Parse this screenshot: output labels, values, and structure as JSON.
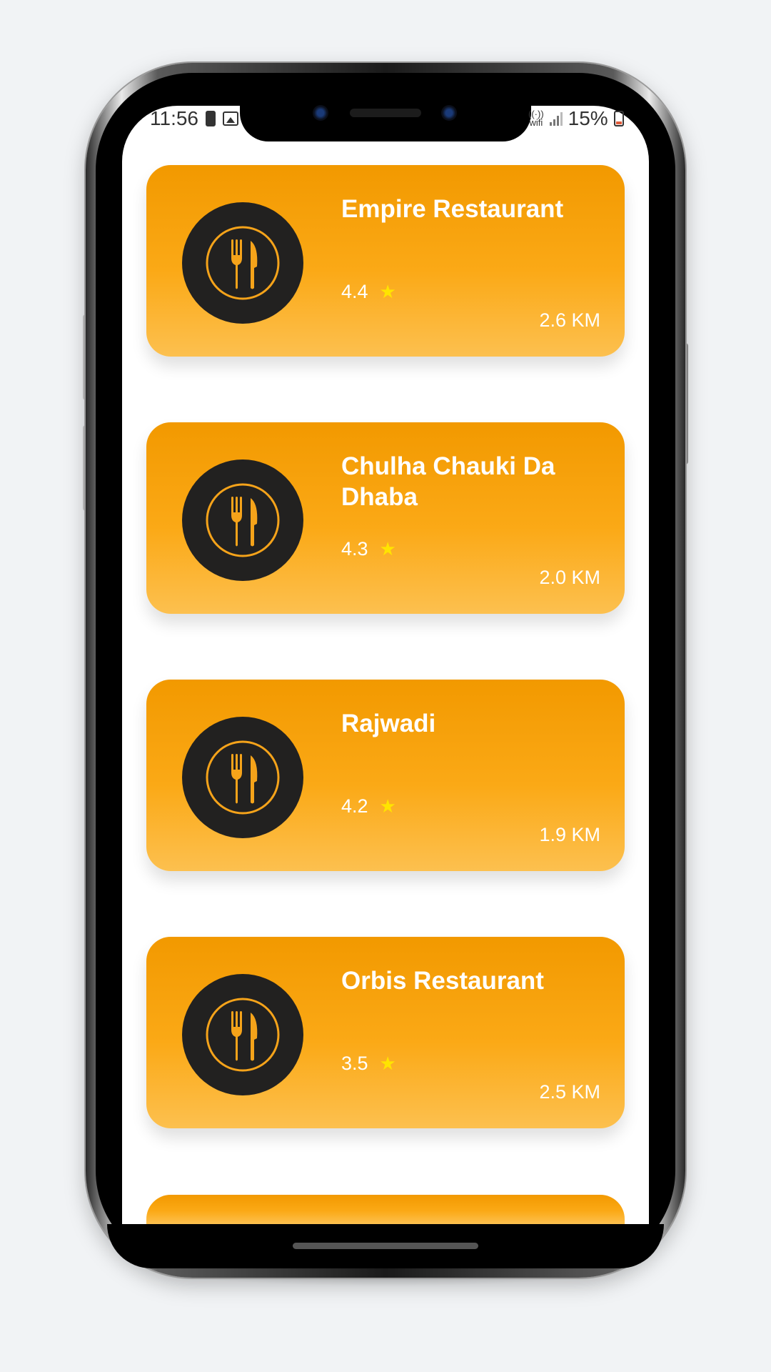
{
  "status_bar": {
    "time": "11:56",
    "wifi_label": "wifi",
    "battery_percent": "15%"
  },
  "restaurants": [
    {
      "name": "Empire Restaurant",
      "rating": "4.4",
      "distance": "2.6 KM"
    },
    {
      "name": "Chulha Chauki Da Dhaba",
      "rating": "4.3",
      "distance": "2.0 KM"
    },
    {
      "name": "Rajwadi",
      "rating": "4.2",
      "distance": "1.9 KM"
    },
    {
      "name": "Orbis Restaurant",
      "rating": "3.5",
      "distance": "2.5 KM"
    }
  ],
  "icons": {
    "card_icon": "fork-knife-plate-icon",
    "rating_icon": "star-icon"
  },
  "colors": {
    "card_top": "#f29900",
    "card_bottom": "#fcc04f",
    "plate": "#222120",
    "star": "#ffe400",
    "text": "#ffffff"
  }
}
